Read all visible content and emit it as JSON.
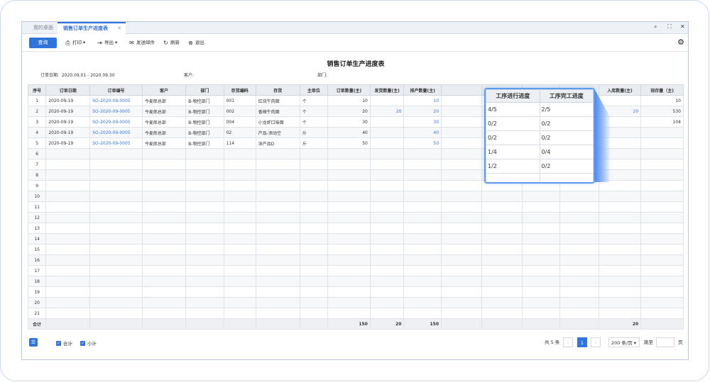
{
  "tabs": {
    "home": "我的桌面",
    "active": "销售订单生产进度表",
    "close": "✕"
  },
  "toolbar": {
    "query": "查询",
    "print": "打印",
    "export": "导出",
    "send_mail": "发送邮件",
    "refresh": "刷新",
    "exit": "退出"
  },
  "report": {
    "title": "销售订单生产进度表",
    "date_label": "订单日期:",
    "date_value": "2020.09.01 - 2020.09.30",
    "customer_label": "客户:",
    "dept_label": "部门:"
  },
  "columns": [
    "序号",
    "订单日期",
    "订单编号",
    "客户",
    "部门",
    "存货编码",
    "存货",
    "主单位",
    "订单数量(主)",
    "发货数量(主)",
    "排产数量(主)",
    "",
    "",
    "",
    "工进度",
    "入库数量(主)",
    "现存量（主)"
  ],
  "rows": [
    [
      "1",
      "2020-09-19",
      "SO-2020-09-0005",
      "今麦郎总部",
      "B-物控部门",
      "001",
      "红烧牛肉面",
      "个",
      "10",
      "",
      "10",
      "",
      "",
      "",
      "",
      "",
      "10"
    ],
    [
      "2",
      "2020-09-19",
      "SO-2020-09-0005",
      "今麦郎总部",
      "B-物控部门",
      "002",
      "香辣牛肉面",
      "个",
      "20",
      "20",
      "20",
      "",
      "",
      "",
      "",
      "20",
      "530"
    ],
    [
      "3",
      "2020-09-19",
      "SO-2020-09-0005",
      "今麦郎总部",
      "B-物控部门",
      "004",
      "小龙虾口味面",
      "个",
      "30",
      "",
      "30",
      "",
      "",
      "",
      "",
      "",
      "104"
    ],
    [
      "4",
      "2020-09-19",
      "SO-2020-09-0005",
      "今麦郎总部",
      "B-物控部门",
      "02",
      "产品-添动空",
      "斤",
      "40",
      "",
      "40",
      "",
      "",
      "",
      "",
      "",
      ""
    ],
    [
      "5",
      "2020-09-19",
      "SO-2020-09-0005",
      "今麦郎总部",
      "B-物控部门",
      "114",
      "深产品D",
      "斤",
      "50",
      "",
      "50",
      "",
      "",
      "",
      "",
      "",
      ""
    ]
  ],
  "empty_row_numbers": [
    "6",
    "7",
    "8",
    "9",
    "10",
    "11",
    "12",
    "13",
    "14",
    "15",
    "16",
    "17",
    "18",
    "19",
    "20",
    "21"
  ],
  "sum_row": {
    "label": "合计",
    "order_qty": "150",
    "ship_qty": "20",
    "plan_qty": "150",
    "in_qty": "20"
  },
  "highlight": {
    "headers": [
      "工序进行进度",
      "工序完工进度"
    ],
    "rows": [
      [
        "4/5",
        "2/5"
      ],
      [
        "0/2",
        "0/2"
      ],
      [
        "0/2",
        "0/2"
      ],
      [
        "1/4",
        "0/4"
      ],
      [
        "1/2",
        "0/2"
      ],
      [
        "",
        ""
      ]
    ]
  },
  "footer": {
    "total_label": "合计",
    "subtotal_label": "小计",
    "count_text": "共 5 条",
    "current_page": "1",
    "page_size": "200 条/页",
    "goto_label": "跳至",
    "page_unit": "页"
  }
}
